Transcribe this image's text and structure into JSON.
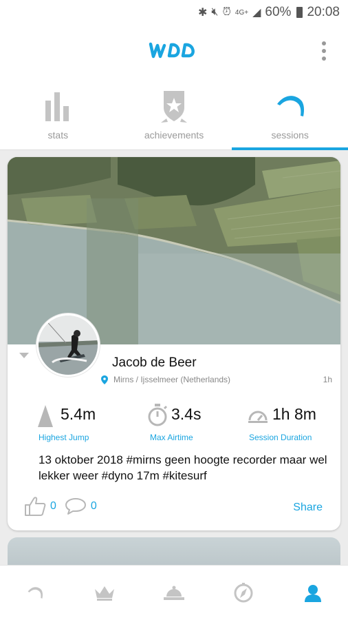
{
  "status_bar": {
    "network": "4G+",
    "battery": "60%",
    "time": "20:08",
    "icons": [
      "bluetooth-icon",
      "mute-icon",
      "alarm-icon",
      "signal-icon",
      "battery-icon"
    ]
  },
  "header": {
    "logo": "WOO",
    "menu_icon": "more-vertical-icon"
  },
  "tabs": [
    {
      "label": "stats",
      "icon": "bar-chart-icon",
      "active": false
    },
    {
      "label": "achievements",
      "icon": "badge-icon",
      "active": false
    },
    {
      "label": "sessions",
      "icon": "session-arc-icon",
      "active": true
    }
  ],
  "session": {
    "user_name": "Jacob de Beer",
    "location": "Mirns / Ijsselmeer (Netherlands)",
    "time_ago": "1h",
    "stats": [
      {
        "value": "5.4m",
        "label": "Highest Jump",
        "icon": "jump-icon"
      },
      {
        "value": "3.4s",
        "label": "Max Airtime",
        "icon": "stopwatch-icon"
      },
      {
        "value": "1h 8m",
        "label": "Session Duration",
        "icon": "duration-icon"
      }
    ],
    "post_text": "13 oktober 2018 #mirns geen hoogte recorder maar wel lekker weer #dyno 17m #kitesurf",
    "likes": "0",
    "comments": "0",
    "share_label": "Share"
  },
  "bottom_nav": [
    {
      "name": "sessions",
      "icon": "session-arc-icon",
      "active": false
    },
    {
      "name": "leaderboard",
      "icon": "crown-icon",
      "active": false
    },
    {
      "name": "spots",
      "icon": "dome-icon",
      "active": false
    },
    {
      "name": "explore",
      "icon": "compass-icon",
      "active": false
    },
    {
      "name": "profile",
      "icon": "profile-icon",
      "active": true
    }
  ],
  "colors": {
    "accent": "#1aa5e0",
    "inactive": "#c4c4c4",
    "background": "#ececec"
  }
}
